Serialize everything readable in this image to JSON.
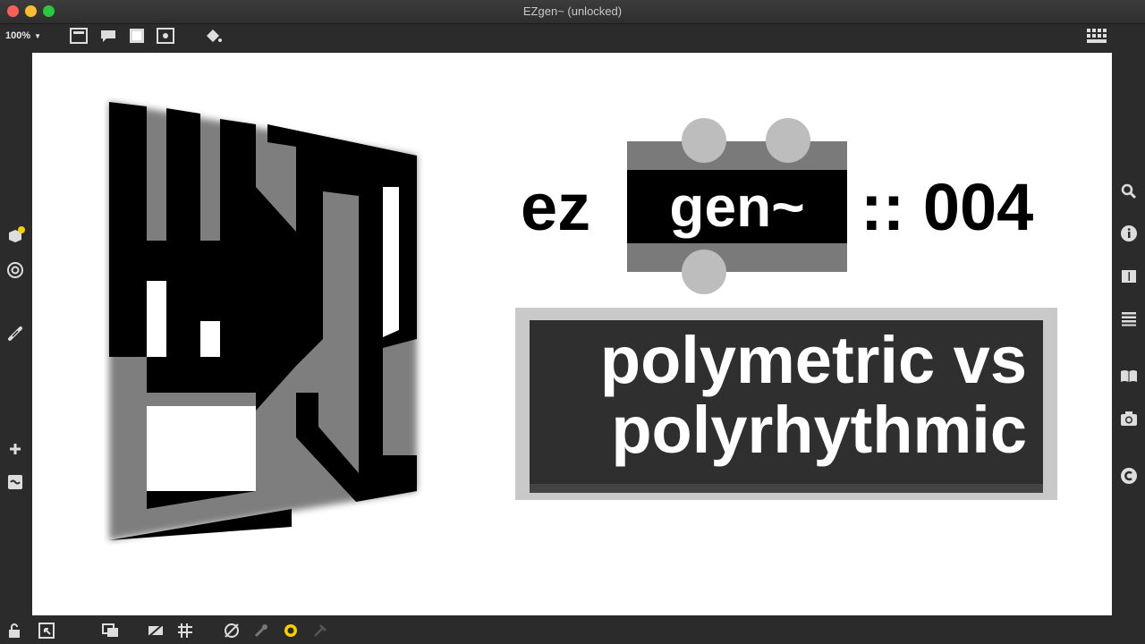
{
  "window": {
    "title": "EZgen~ (unlocked)",
    "zoom": "100%"
  },
  "toolbar": {
    "icons": [
      "presentation-icon",
      "comment-icon",
      "grid-icon",
      "snap-icon",
      "paint-bucket-icon",
      "grid-view-icon"
    ]
  },
  "canvas": {
    "prefix": "ez",
    "gen_label": "gen~",
    "episode": ":: 004",
    "subtitle_line1": "polymetric vs",
    "subtitle_line2": "polyrhythmic"
  },
  "leftbar": {
    "icons": [
      "cube-icon",
      "target-icon",
      "link-icon",
      "plus-icon",
      "patch-icon"
    ]
  },
  "rightbar": {
    "icons": [
      "search-icon",
      "info-icon",
      "sidebar-icon",
      "list-icon",
      "book-icon",
      "camera-icon",
      "copyright-icon"
    ]
  },
  "bottombar": {
    "icons": [
      "lock-icon",
      "window-icon",
      "stack-icon",
      "hide-icon",
      "grid-icon",
      "visibility-icon",
      "wrench-icon",
      "circle-icon",
      "bug-icon"
    ]
  },
  "colors": {
    "window_bg": "#2b2b2b",
    "canvas_bg": "#ffffff",
    "gen_box": "#7a7a7a",
    "subtitle_bg": "#2f2f2f"
  }
}
